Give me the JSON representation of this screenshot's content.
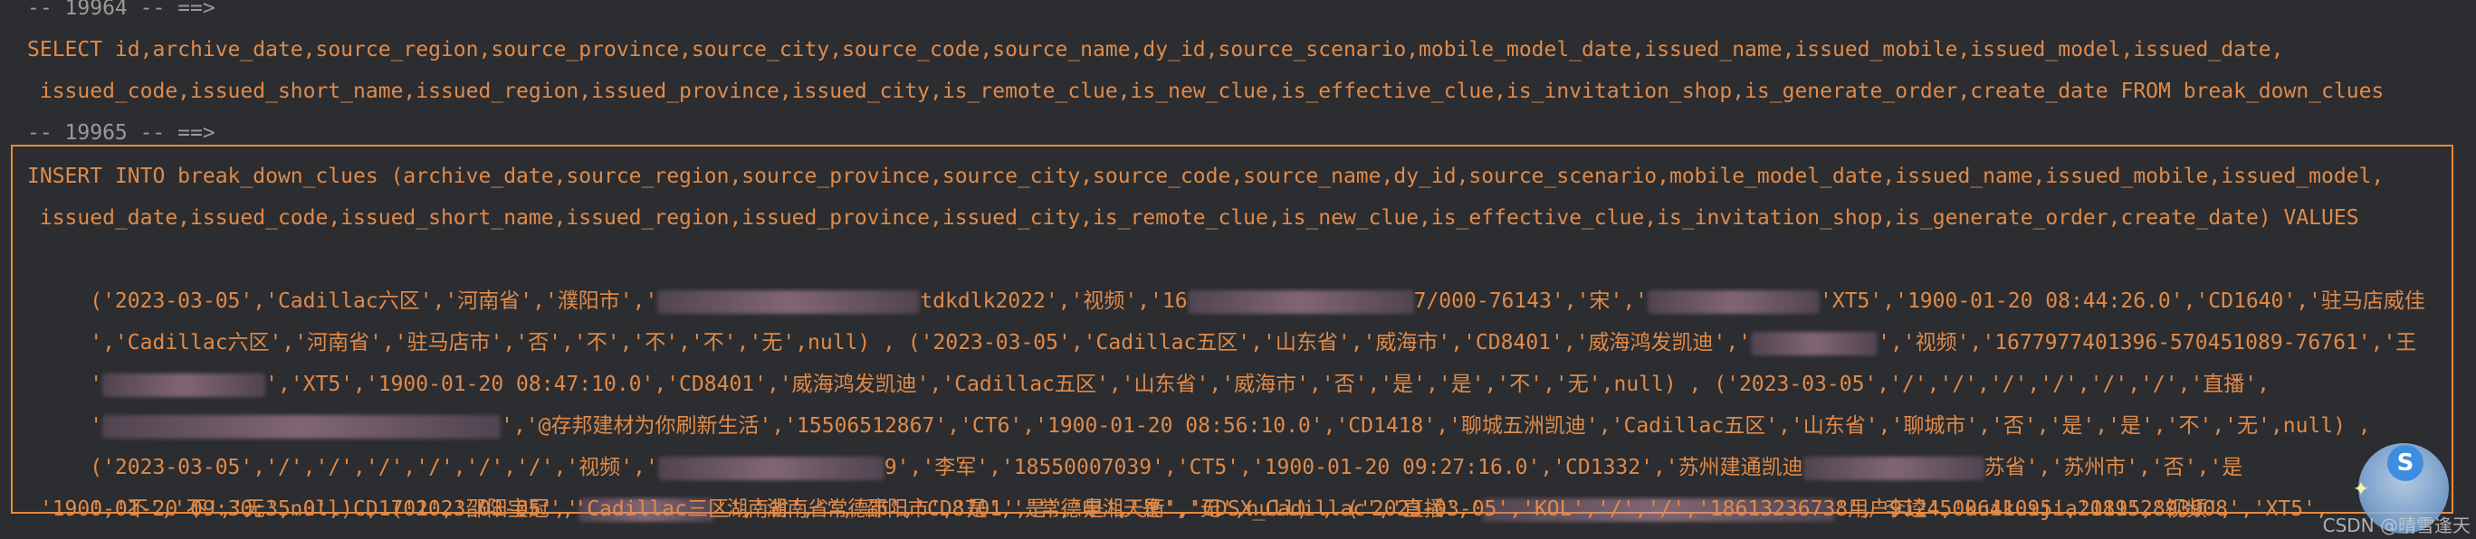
{
  "lines": {
    "c1": "-- 19964 -- ==>",
    "s1a": "SELECT id,archive_date,source_region,source_province,source_city,source_code,source_name,dy_id,source_scenario,mobile_model_date,issued_name,issued_mobile,issued_model,issued_date,",
    "s1b": " issued_code,issued_short_name,issued_region,issued_province,issued_city,is_remote_clue,is_new_clue,is_effective_clue,is_invitation_shop,is_generate_order,create_date FROM break_down_clues",
    "c2": "-- 19965 -- ==>",
    "i1": "INSERT INTO break_down_clues (archive_date,source_region,source_province,source_city,source_code,source_name,dy_id,source_scenario,mobile_model_date,issued_name,issued_mobile,issued_model,",
    "i2": " issued_date,issued_code,issued_short_name,issued_region,issued_province,issued_city,is_remote_clue,is_new_clue,is_effective_clue,is_invitation_shop,is_generate_order,create_date) VALUES",
    "v1a": " ('2023-03-05','Cadillac六区','河南省','濮阳市','",
    "v1b": "tdkdlk2022','视频','16",
    "v1c": "7/000-76143','宋','",
    "v1d": "'XT5','1900-01-20 08:44:26.0','CD1640','驻马店威佳",
    "v2a": " ','Cadillac六区','河南省','驻马店市','否','不','不','不','无',null) , ('2023-03-05','Cadillac五区','山东省','威海市','CD8401','威海鸿发凯迪','",
    "v2b": "','视频','1677977401396-570451089-76761','王",
    "v3a": " '",
    "v3b": "','XT5','1900-01-20 08:47:10.0','CD8401','威海鸿发凯迪','Cadillac五区','山东省','威海市','否','是','是','不','无',null) , ('2023-03-05','/','/','/','/','/','/','直播',",
    "v4a": " '",
    "v4b": "','@存邦建材为你刷新生活','15506512867','CT6','1900-01-20 08:56:10.0','CD1418','聊城五洲凯迪','Cadillac五区','山东省','聊城市','否','是','是','不','无',null) ,",
    "v5a": " ('2023-03-05','/','/','/','/','/','/','视频','",
    "v5b": "9','李军','18550007039','CT5','1900-01-20 09:27:16.0','CD1332','苏州建通凯迪",
    "v5c": "苏省','苏州市','否','是",
    "v6a": " ','不','不','无',null) , ('2023-03-05','",
    "v6b": "'湖南省','常德市','CD8701','常德申湘天衡','CDSX_Cadillac','直播','",
    "v6c": "'用户9124500641095','18152893908','XT5',",
    "v7": " '1900-01-20 09:30:35.0','CD1701','邵阳宝冠','Cadillac三区','湖南省','邵阳市','是','是','是','是','无',null) , ('2023-03-05','KOL','/','/','18613236738','李逵','kuikuijia2019','视频',"
  },
  "watermark": "CSDN @晴雪逢天",
  "badge_letter": "S",
  "colors": {
    "background": "#2b2d30",
    "sql_text": "#e08a4a",
    "comment_text": "#9a9a9a",
    "highlight_border": "#e98a3a"
  }
}
